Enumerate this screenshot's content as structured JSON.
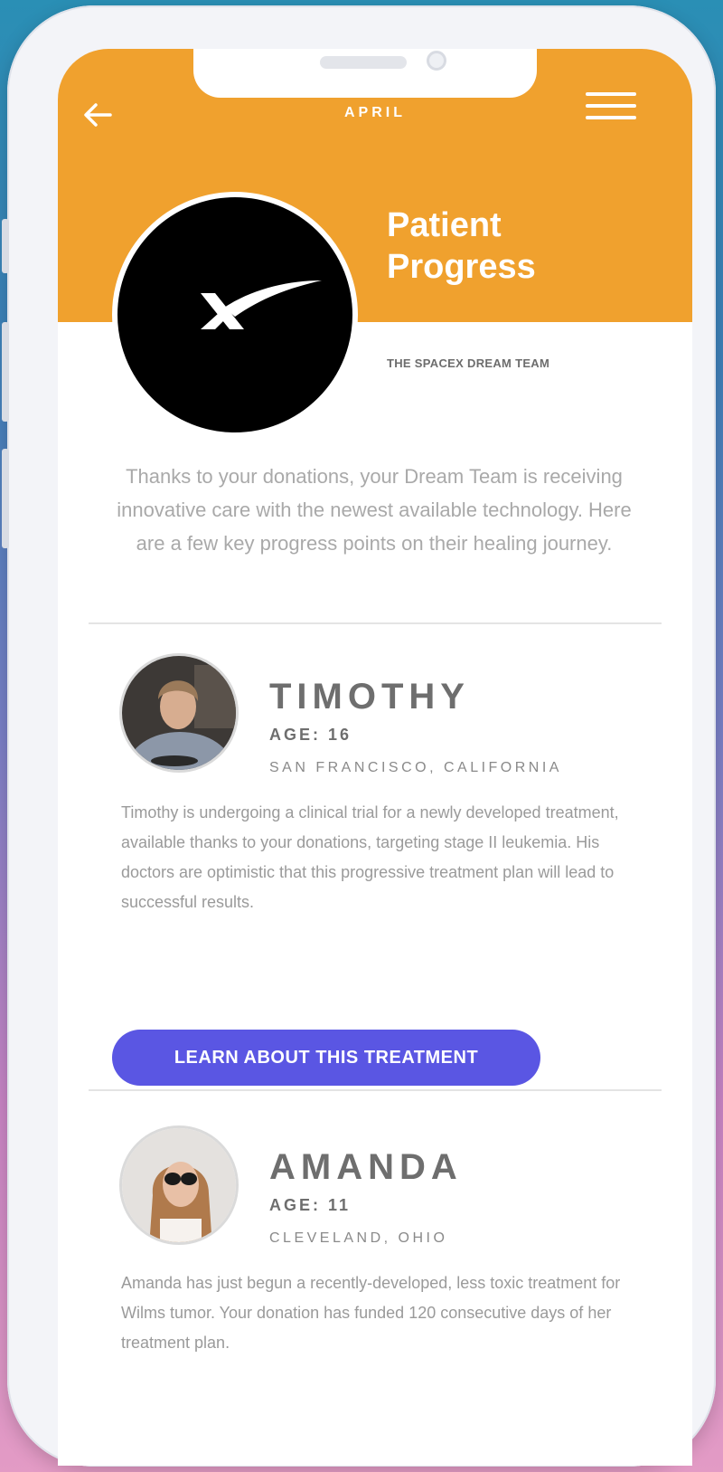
{
  "header": {
    "back_icon": "arrow-left-icon",
    "month": "APRIL",
    "menu_icon": "hamburger-menu-icon",
    "title_line1": "Patient",
    "title_line2": "Progress",
    "team_name": "THE SPACEX DREAM TEAM",
    "brand_color": "#f0a12e"
  },
  "intro": "Thanks to your donations, your Dream Team is receiving innovative care with the newest available technology. Here are a few key progress points on their healing journey.",
  "patients": [
    {
      "name": "TIMOTHY",
      "age": "AGE: 16",
      "location": "SAN FRANCISCO, CALIFORNIA",
      "description": "Timothy is undergoing a clinical trial for a newly developed treatment, available thanks to your donations, targeting stage II leukemia. His doctors are optimistic that this progressive treatment plan will lead to successful results.",
      "button_label": "LEARN ABOUT THIS TREATMENT"
    },
    {
      "name": "AMANDA",
      "age": "AGE: 11",
      "location": "CLEVELAND, OHIO",
      "description": "Amanda has just begun a recently-developed, less toxic treatment for Wilms tumor. Your donation has funded 120 consecutive days of her treatment plan."
    }
  ],
  "accent_color": "#5a56e3"
}
